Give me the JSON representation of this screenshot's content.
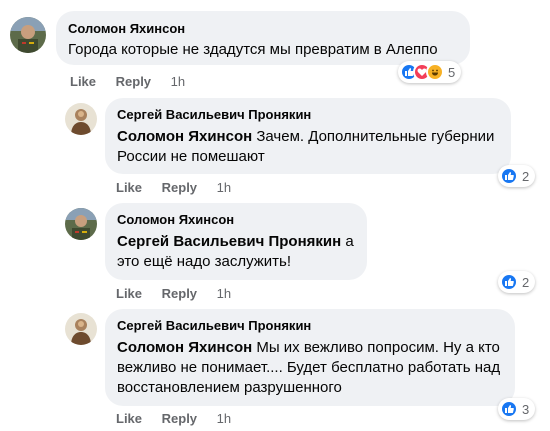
{
  "comments": [
    {
      "author": "Соломон Яхинсон",
      "mention": "",
      "text": "Города которые не здадутся мы превратим в Алеппо",
      "like_label": "Like",
      "reply_label": "Reply",
      "time": "1h",
      "reaction_icons": [
        "like-icon",
        "love-icon",
        "haha-icon"
      ],
      "reaction_count": "5"
    },
    {
      "author": "Сергей Васильевич Пронякин",
      "mention": "Соломон Яхинсон",
      "text": "Зачем. Дополнительные губернии России не помешают",
      "like_label": "Like",
      "reply_label": "Reply",
      "time": "1h",
      "reaction_icons": [
        "like-icon"
      ],
      "reaction_count": "2"
    },
    {
      "author": "Соломон Яхинсон",
      "mention": "Сергей Васильевич Пронякин",
      "text": "а это ещё надо заслужить!",
      "like_label": "Like",
      "reply_label": "Reply",
      "time": "1h",
      "reaction_icons": [
        "like-icon"
      ],
      "reaction_count": "2"
    },
    {
      "author": "Сергей Васильевич Пронякин",
      "mention": "Соломон Яхинсон",
      "text": "Мы их вежливо попросим. Ну а кто вежливо не понимает.... Будет бесплатно работать над восстановлением разрушенного",
      "like_label": "Like",
      "reply_label": "Reply",
      "time": "1h",
      "reaction_icons": [
        "like-icon"
      ],
      "reaction_count": "3"
    }
  ],
  "colors": {
    "bubble": "#eff1f4",
    "meta_text": "#65676b",
    "like_blue": "#1877f2",
    "love_red": "#f33e58",
    "haha_yellow": "#f7b125"
  }
}
